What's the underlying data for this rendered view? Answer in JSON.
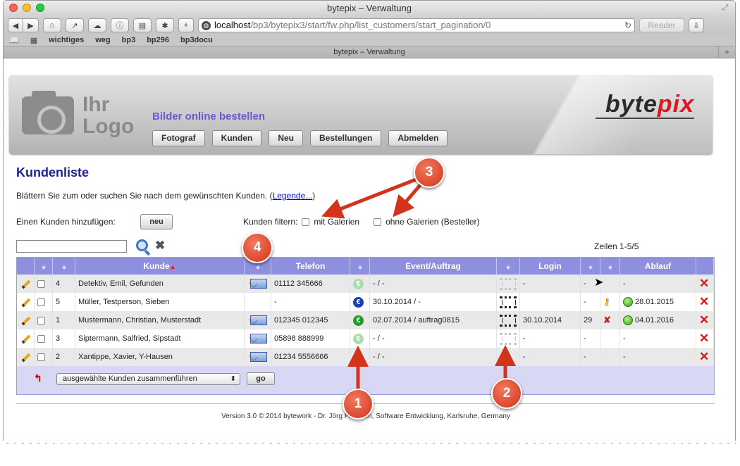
{
  "window": {
    "title": "bytepix – Verwaltung"
  },
  "toolbar": {
    "url_host": "localhost",
    "url_path": "/bp3/bytepix3/start/fw.php/list_customers/start_pagination/0",
    "reader": "Reader"
  },
  "bookmarks": [
    "wichtiges",
    "weg",
    "bp3",
    "bp296",
    "bp3docu"
  ],
  "tab": {
    "title": "bytepix – Verwaltung"
  },
  "banner": {
    "logo_line1": "Ihr",
    "logo_line2": "Logo",
    "slogan": "Bilder online bestellen",
    "brand_a": "byte",
    "brand_b": "pix",
    "nav": [
      "Fotograf",
      "Kunden",
      "Neu",
      "Bestellungen",
      "Abmelden"
    ]
  },
  "main": {
    "title": "Kundenliste",
    "intro": "Blättern Sie zum oder suchen Sie nach dem gewünschten Kunden. (",
    "legend_link": "Legende...",
    "intro_end": ")",
    "add_label": "Einen Kunden hinzufügen:",
    "add_button": "neu",
    "filter_label": "Kunden filtern:",
    "filter_with": "mit Galerien",
    "filter_without": "ohne Galerien (Besteller)",
    "rows_info": "Zeilen 1-5/5"
  },
  "table": {
    "headers": [
      "Kunde",
      "Telefon",
      "Event/Auftrag",
      "Login",
      "Ablauf"
    ],
    "rows": [
      {
        "nr": "4",
        "name": "Detektiv, Emil, Gefunden",
        "phone": "01112 345666",
        "event": "- / -",
        "login": "-",
        "count": "-",
        "ablauf": "-"
      },
      {
        "nr": "5",
        "name": "Müller, Testperson, Sieben",
        "phone": "-",
        "event": "30.10.2014 / -",
        "login": "",
        "count": "-",
        "ablauf": "28.01.2015"
      },
      {
        "nr": "1",
        "name": "Mustermann, Christian, Musterstadt",
        "phone": "012345 012345",
        "event": "02.07.2014 / auftrag0815",
        "login": "30.10.2014",
        "count": "29",
        "ablauf": "04.01.2016"
      },
      {
        "nr": "3",
        "name": "Siptermann, Salfried, Sipstadt",
        "phone": "05898 888999",
        "event": "- / -",
        "login": "-",
        "count": "-",
        "ablauf": "-"
      },
      {
        "nr": "2",
        "name": "Xantippe, Xavier, Y-Hausen",
        "phone": "01234 5556666",
        "event": "- / -",
        "login": "-",
        "count": "-",
        "ablauf": "-"
      }
    ]
  },
  "merge": {
    "select": "ausgewählte Kunden zusammenführen",
    "go": "go"
  },
  "footer": {
    "text": "Version 3.0 © 2014 bytework - Dr. Jörg Fr... ...ch, Software Entwicklung, Karlsruhe, Germany"
  },
  "annotations": [
    "1",
    "2",
    "3",
    "4"
  ],
  "colors": {
    "accent": "#8f8fe0",
    "title": "#20209a",
    "annotation": "#d2331b",
    "brand_red": "#e0151e"
  }
}
